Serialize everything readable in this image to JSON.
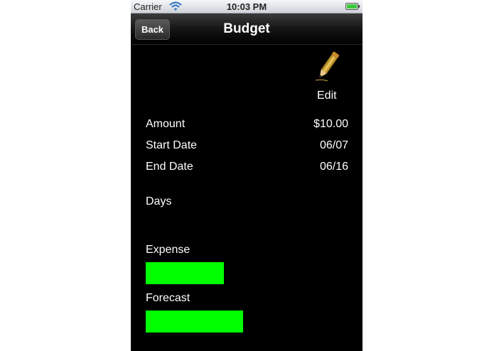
{
  "status_bar": {
    "carrier": "Carrier",
    "time": "10:03 PM",
    "wifi_icon": "wifi-icon",
    "battery_icon": "battery-icon"
  },
  "nav_bar": {
    "back_label": "Back",
    "title": "Budget"
  },
  "edit": {
    "icon": "pencil-icon",
    "label": "Edit"
  },
  "details": {
    "amount_label": "Amount",
    "amount_value": "$10.00",
    "start_label": "Start Date",
    "start_value": "06/07",
    "end_label": "End Date",
    "end_value": "06/16",
    "days_label": "Days"
  },
  "bars": {
    "expense_label": "Expense",
    "forecast_label": "Forecast",
    "bar_color": "#00ff00"
  }
}
